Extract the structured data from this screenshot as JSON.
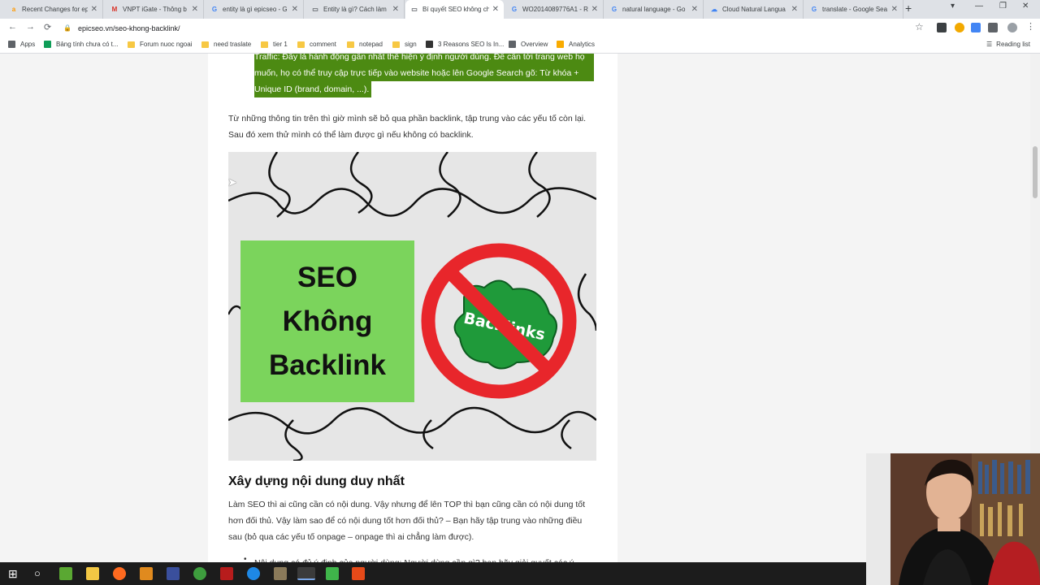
{
  "tabs": [
    {
      "title": "Recent Changes for ep",
      "icon": "amazon-icon",
      "icon_color": "#ff9900",
      "glyph": "a"
    },
    {
      "title": "VNPT iGate - Thông b",
      "icon": "gmail-icon",
      "icon_color": "#d93025",
      "glyph": "M"
    },
    {
      "title": "entity là gì epicseo - G",
      "icon": "google-icon",
      "icon_color": "#4285f4",
      "glyph": "G"
    },
    {
      "title": "Entity là gì? Cách làm",
      "icon": "page-icon",
      "icon_color": "#5f6368",
      "glyph": "▭"
    },
    {
      "title": "Bí quyết SEO không ch",
      "icon": "page-icon",
      "icon_color": "#5f6368",
      "glyph": "▭"
    },
    {
      "title": "WO2014089776A1 - R",
      "icon": "google-icon",
      "icon_color": "#4285f4",
      "glyph": "G"
    },
    {
      "title": "natural language - Go",
      "icon": "google-icon",
      "icon_color": "#4285f4",
      "glyph": "G"
    },
    {
      "title": "Cloud Natural Langua",
      "icon": "cloud-icon",
      "icon_color": "#4285f4",
      "glyph": "☁"
    },
    {
      "title": "translate - Google Sea",
      "icon": "google-icon",
      "icon_color": "#4285f4",
      "glyph": "G"
    }
  ],
  "active_tab_index": 4,
  "new_tab_glyph": "+",
  "window_controls": {
    "minimize": "—",
    "restore": "❐",
    "close": "✕"
  },
  "toolbar": {
    "back": "←",
    "forward": "→",
    "reload": "C",
    "url": "epicseo.vn/seo-khong-backlink/"
  },
  "bookmarks": [
    {
      "label": "Apps",
      "icon": "apps-grid-icon"
    },
    {
      "label": "Bảng tính chưa có t...",
      "icon": "sheets-icon"
    },
    {
      "label": "Forum nuoc ngoai",
      "icon": "folder-icon"
    },
    {
      "label": "need traslate",
      "icon": "folder-icon"
    },
    {
      "label": "tier 1",
      "icon": "folder-icon"
    },
    {
      "label": "comment",
      "icon": "folder-icon"
    },
    {
      "label": "notepad",
      "icon": "folder-icon"
    },
    {
      "label": "sign",
      "icon": "folder-icon"
    },
    {
      "label": "3 Reasons SEO Is In...",
      "icon": "seo-icon"
    },
    {
      "label": "Overview",
      "icon": "gear-icon"
    },
    {
      "label": "Analytics",
      "icon": "analytics-icon"
    }
  ],
  "reading_list": "Reading list",
  "article": {
    "highlight_lines": [
      "Traffic: Đây là hành động gần nhất thể hiện ý định người dùng. Đề cần tới trang web họ",
      "muốn, họ có thể truy cập trực tiếp vào website hoặc lên Google Search gõ: Từ khóa +",
      "Unique ID (brand, domain, ...)."
    ],
    "intro_paragraph": "Từ những thông tin trên thì giờ mình sẽ bỏ qua phần backlink, tập trung vào các yếu tố còn lại. Sau đó xem thử mình có thể làm được gì nếu không có backlink.",
    "hero": {
      "line1": "SEO",
      "line2": "Không",
      "line3": "Backlink",
      "badge": "Backlinks"
    },
    "heading": "Xây dựng nội dung duy nhất",
    "body_paragraph": "Làm SEO thì ai cũng cần có nội dung. Vậy nhưng để lên TOP thì bạn cũng cần có nội dung tốt hơn đối thủ. Vậy làm sao để có nội dung tốt hơn đối thủ? – Bạn hãy tập trung vào những điều sau (bỏ qua các yếu tố onpage – onpage thì ai chẳng làm được).",
    "bullet": "Nội dung có đủ ý định của người dùng: Người dùng cần gì? bạn hãy giải quyết các ý"
  }
}
